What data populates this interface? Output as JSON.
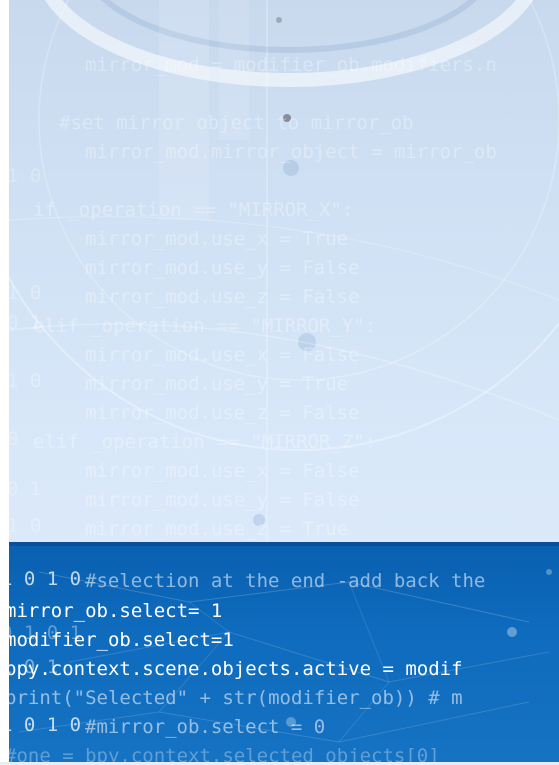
{
  "top_code": {
    "line1": "mirror_mod = modifier_ob.modifiers.n",
    "line2": "#set mirror object to mirror_ob",
    "line3": "mirror_mod.mirror_object = mirror_ob",
    "line4": "if _operation == \"MIRROR_X\":",
    "line5": "mirror_mod.use_x = True",
    "line6": "mirror_mod.use_y = False",
    "line7": "mirror_mod.use_z = False",
    "line8": "elif _operation == \"MIRROR_Y\":",
    "line9": "mirror_mod.use_x = False",
    "line10": "mirror_mod.use_y = True",
    "line11": "mirror_mod.use_z = False",
    "line12": "elif _operation == \"MIRROR_Z\":",
    "line13": "mirror_mod.use_x = False",
    "line14": "mirror_mod.use_y = False",
    "line15": "mirror_mod.use_z = True"
  },
  "bottom_code": {
    "line1": "#selection at the end -add back the",
    "line2": "mirror_ob.select= 1",
    "line3": "modifier_ob.select=1",
    "line4": "bpy.context.scene.objects.active = modif",
    "line5": "print(\"Selected\" + str(modifier_ob)) # m",
    "line6": "#mirror_ob.select = 0",
    "line7": "#one = bpy.context.selected_objects[0]"
  },
  "binary_digits": {
    "d1": "1 0",
    "d2": "1 0",
    "d3": "0 1",
    "d4": "1 0",
    "d5": "0",
    "d6": "0 1",
    "d7": "1 0",
    "d8": "1 0 1 0",
    "d9": "0 1 0 1",
    "d10": "1 0 1",
    "d11": "1 0 1 0"
  },
  "colors": {
    "top_bg": "#cfe0f4",
    "bottom_bg": "#0e6bbd",
    "bottom_border": "#0b4f9a"
  }
}
